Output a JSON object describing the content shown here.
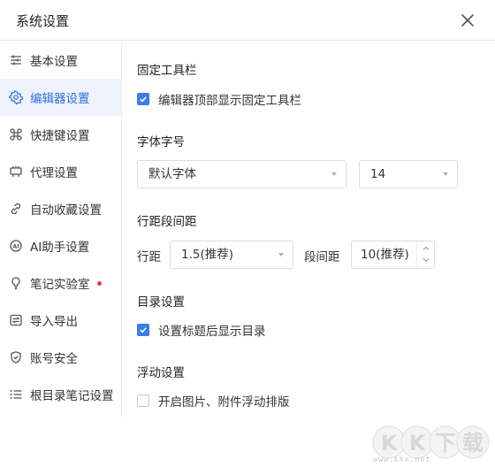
{
  "window": {
    "title": "系统设置"
  },
  "sidebar": {
    "items": [
      {
        "label": "基本设置",
        "icon": "sliders-icon"
      },
      {
        "label": "编辑器设置",
        "icon": "gear-icon",
        "active": true
      },
      {
        "label": "快捷键设置",
        "icon": "command-icon"
      },
      {
        "label": "代理设置",
        "icon": "proxy-icon"
      },
      {
        "label": "自动收藏设置",
        "icon": "link-icon"
      },
      {
        "label": "AI助手设置",
        "icon": "ai-icon"
      },
      {
        "label": "笔记实验室",
        "icon": "bulb-icon",
        "badge_color": "#e83b3b"
      },
      {
        "label": "导入导出",
        "icon": "import-export-icon"
      },
      {
        "label": "账号安全",
        "icon": "shield-icon"
      },
      {
        "label": "根目录笔记设置",
        "icon": "list-icon"
      }
    ]
  },
  "main": {
    "toolbar_section": {
      "title": "固定工具栏",
      "checkbox_label": "编辑器顶部显示固定工具栏",
      "checked": true
    },
    "font_section": {
      "title": "字体字号",
      "font_value": "默认字体",
      "size_value": "14"
    },
    "spacing_section": {
      "title": "行距段间距",
      "line_label": "行距",
      "line_value": "1.5(推荐)",
      "para_label": "段间距",
      "para_value": "10(推荐)"
    },
    "toc_section": {
      "title": "目录设置",
      "checkbox_label": "设置标题后显示目录",
      "checked": true
    },
    "float_section": {
      "title": "浮动设置",
      "checkbox_label": "开启图片、附件浮动排版",
      "checked": false
    }
  },
  "watermark": {
    "logo_text": "KK下载",
    "url_text": "www.kkx.net"
  },
  "colors": {
    "accent": "#3a7de8",
    "active_bg": "#eef3fd",
    "badge": "#e83b3b"
  }
}
